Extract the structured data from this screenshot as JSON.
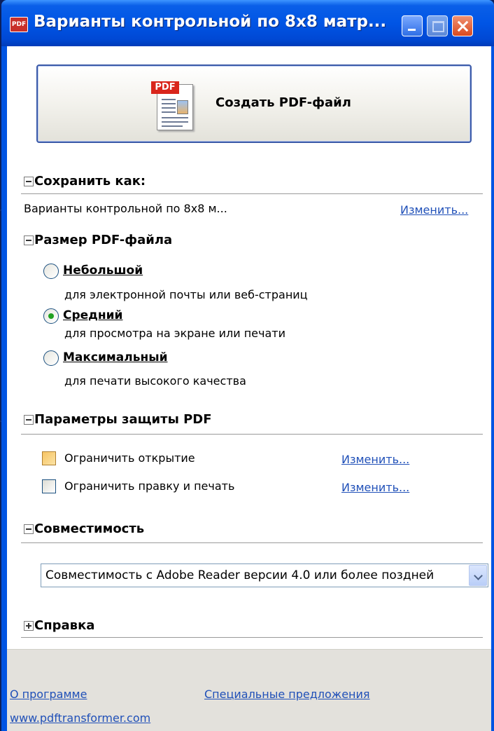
{
  "window": {
    "title": "Варианты контрольной по 8x8 матр...",
    "icon_text": "PDF"
  },
  "create_button": {
    "label": "Создать PDF-файл",
    "icon_tag": "PDF"
  },
  "save_as": {
    "title": "Сохранить как:",
    "filename": "Варианты контрольной по 8x8 м...",
    "change_link": "Изменить..."
  },
  "pdf_size": {
    "title": "Размер PDF-файла",
    "options": [
      {
        "label": "Небольшой",
        "desc": "для электронной почты или веб-страниц",
        "selected": false
      },
      {
        "label": "Средний",
        "desc": "для просмотра на экране или печати",
        "selected": true
      },
      {
        "label": "Максимальный",
        "desc": "для печати высокого качества",
        "selected": false
      }
    ]
  },
  "security": {
    "title": "Параметры защиты PDF",
    "restrict_open": {
      "label": "Ограничить открытие",
      "link": "Изменить...",
      "checked": false
    },
    "restrict_edit": {
      "label": "Ограничить правку и печать",
      "link": "Изменить...",
      "checked": false
    }
  },
  "compatibility": {
    "title": "Совместимость",
    "selected": "Совместимость с Adobe Reader версии 4.0 или более поздней"
  },
  "help": {
    "title": "Справка"
  },
  "footer": {
    "about": "О программе",
    "offers": "Специальные предложения",
    "website": "www.pdftransformer.com"
  },
  "colors": {
    "titlebar": "#0055e5",
    "link": "#2050b8",
    "radio_selected": "#21a121",
    "checkbox_hover": "#f7c463"
  }
}
